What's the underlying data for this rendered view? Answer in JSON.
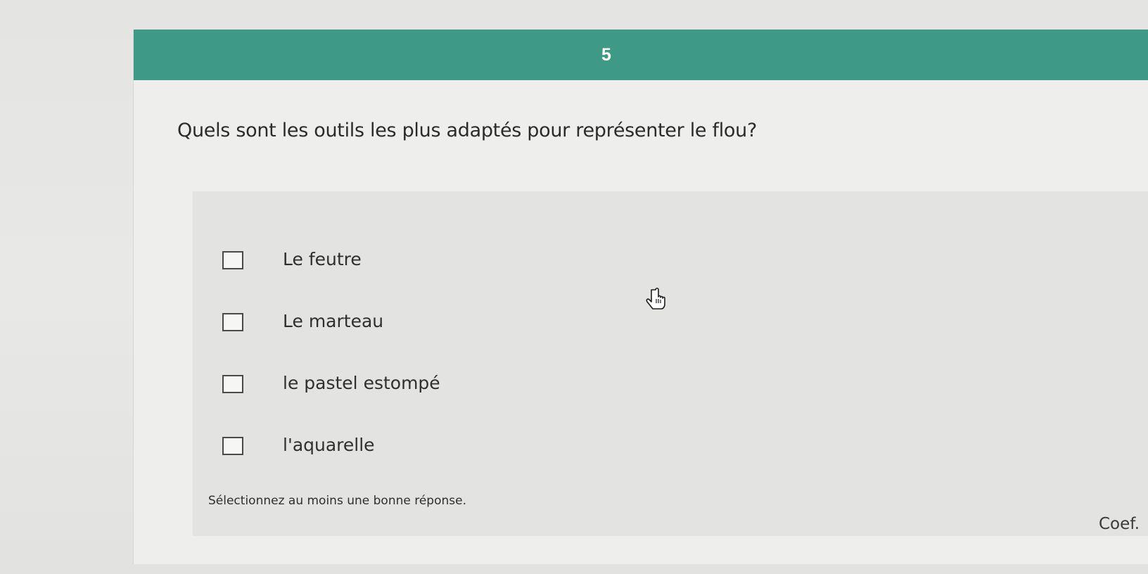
{
  "question": {
    "number": "5",
    "text": "Quels sont les outils les plus adaptés pour représenter le flou?",
    "options": [
      {
        "label": "Le feutre",
        "checked": false
      },
      {
        "label": "Le marteau",
        "checked": false
      },
      {
        "label": "le pastel estompé",
        "checked": false
      },
      {
        "label": "l'aquarelle",
        "checked": false
      }
    ],
    "hint": "Sélectionnez au moins une bonne réponse.",
    "coef_label": "Coef."
  },
  "colors": {
    "header": "#3e9a86",
    "background": "#e9e9e7",
    "panel": "#e3e3e1"
  },
  "icons": {
    "cursor": "hand-pointer-icon"
  }
}
